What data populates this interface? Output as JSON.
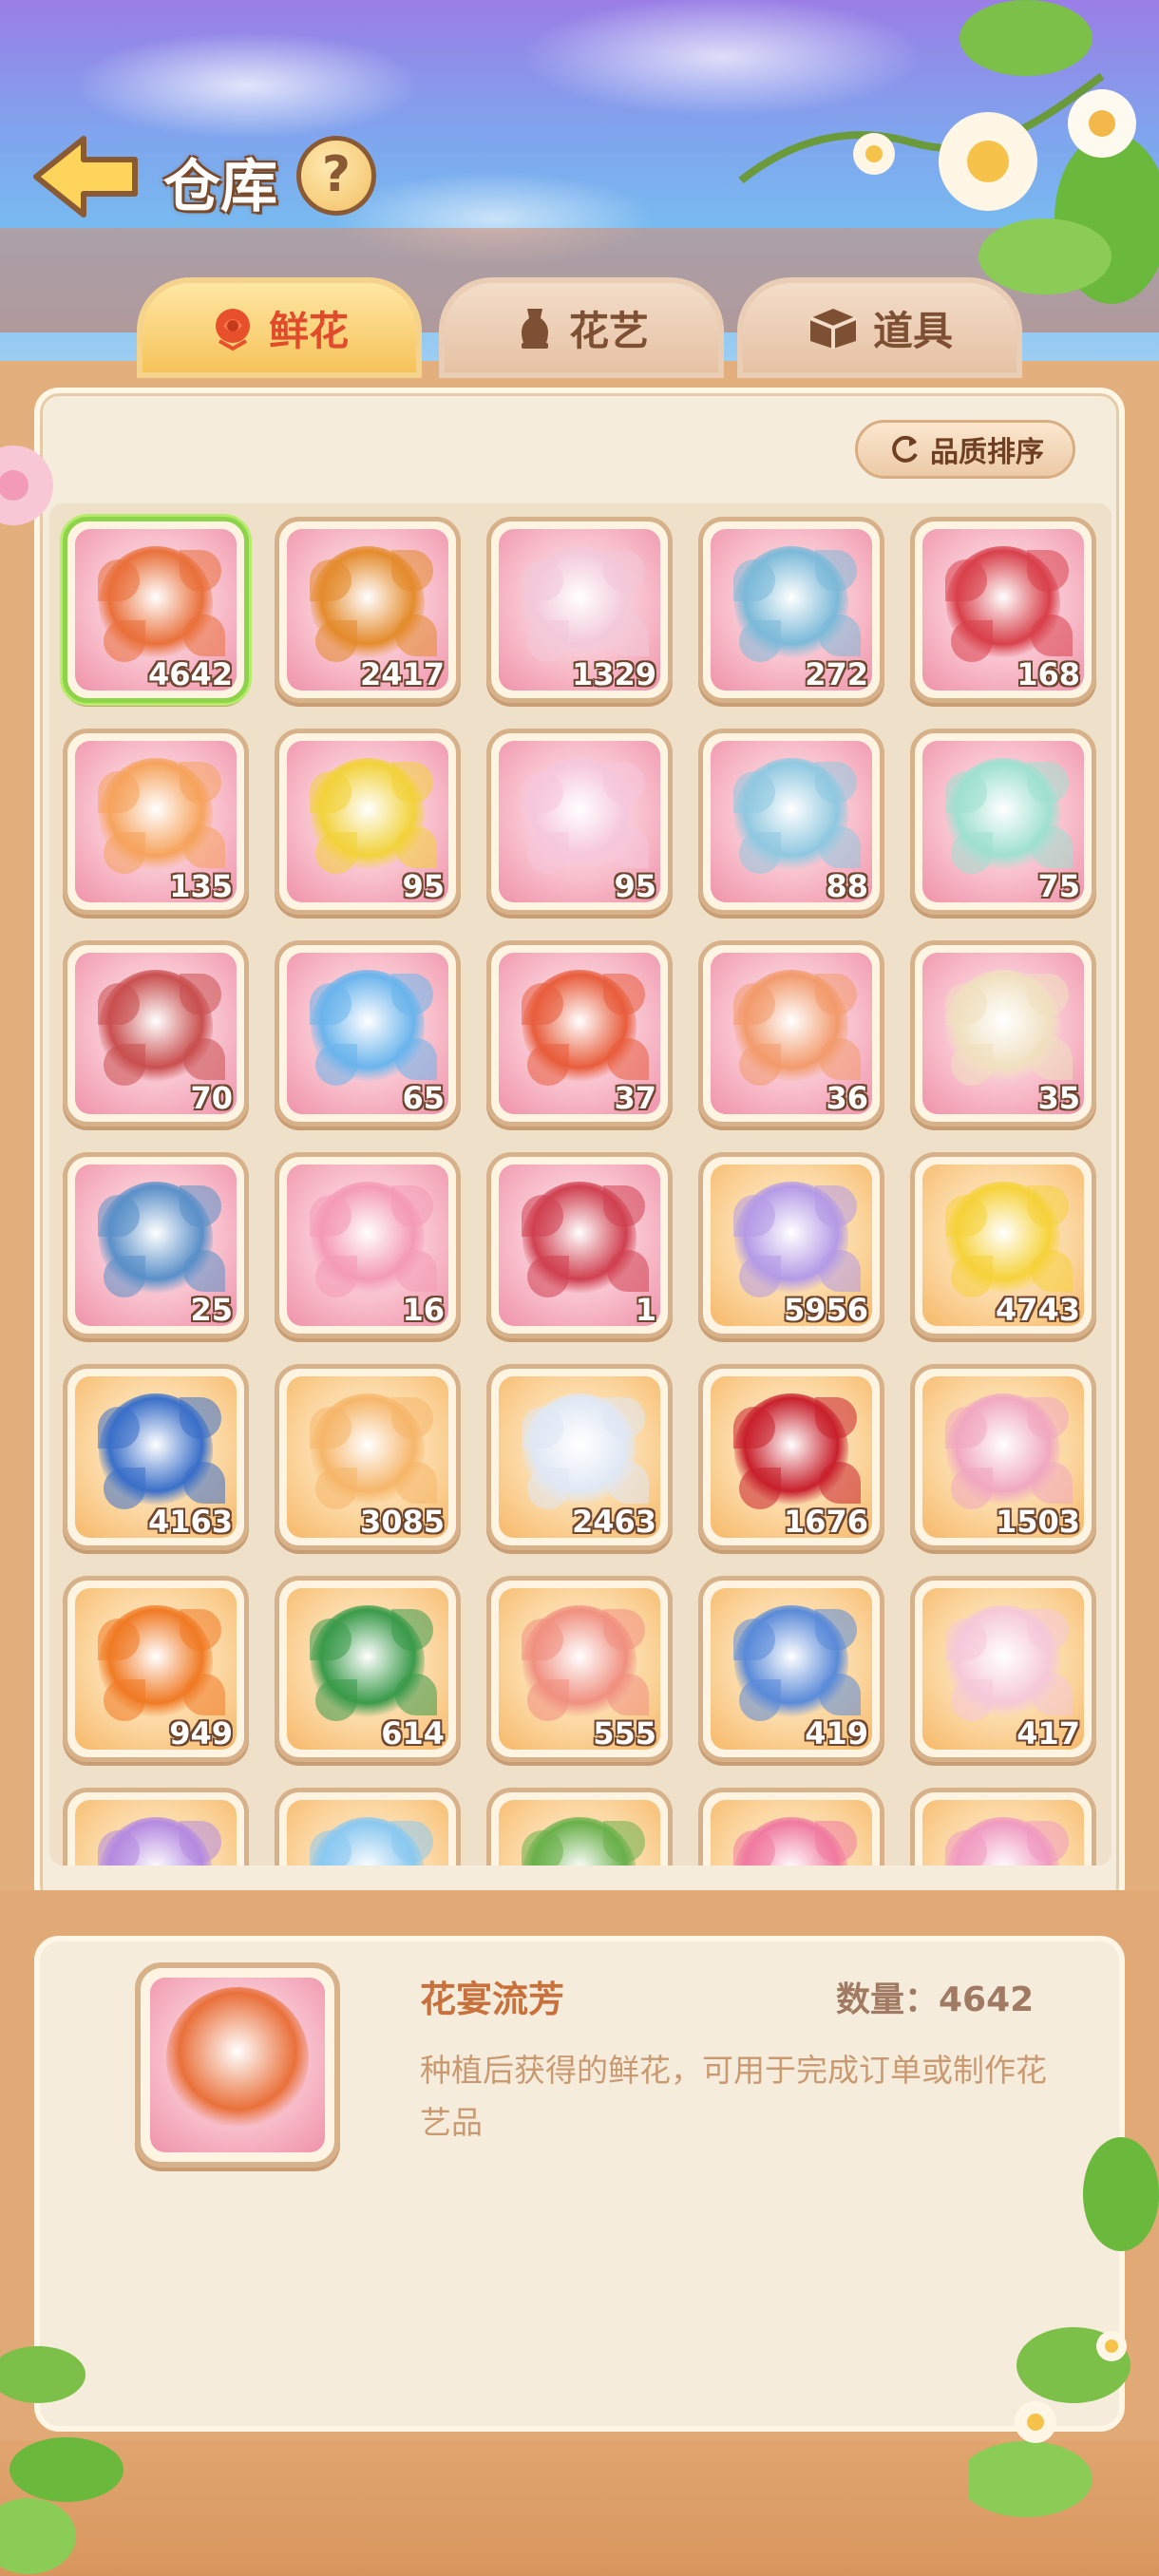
{
  "header": {
    "title": "仓库",
    "help_label": "?"
  },
  "tabs": [
    {
      "label": "鲜花",
      "active": true,
      "icon": "rose-icon"
    },
    {
      "label": "花艺",
      "active": false,
      "icon": "vase-icon"
    },
    {
      "label": "道具",
      "active": false,
      "icon": "box-icon"
    }
  ],
  "sort_button": {
    "label": "品质排序",
    "icon": "refresh-icon"
  },
  "items": [
    {
      "count": "4642",
      "bg": "pink",
      "color": "#e9703a",
      "selected": true
    },
    {
      "count": "2417",
      "bg": "pink",
      "color": "#e48b2c"
    },
    {
      "count": "1329",
      "bg": "pink",
      "color": "#f3c8d8"
    },
    {
      "count": "272",
      "bg": "pink",
      "color": "#7bb9d8"
    },
    {
      "count": "168",
      "bg": "pink",
      "color": "#d8404a"
    },
    {
      "count": "135",
      "bg": "pink",
      "color": "#f6a35c"
    },
    {
      "count": "95",
      "bg": "pink",
      "color": "#f2d23b"
    },
    {
      "count": "95",
      "bg": "pink",
      "color": "#f6c6dc"
    },
    {
      "count": "88",
      "bg": "pink",
      "color": "#8fc8e0"
    },
    {
      "count": "75",
      "bg": "pink",
      "color": "#9fe0d0"
    },
    {
      "count": "70",
      "bg": "pink",
      "color": "#c94f4f"
    },
    {
      "count": "65",
      "bg": "pink",
      "color": "#6ab4ec"
    },
    {
      "count": "37",
      "bg": "pink",
      "color": "#e85d3c"
    },
    {
      "count": "36",
      "bg": "pink",
      "color": "#f29a6c"
    },
    {
      "count": "35",
      "bg": "pink",
      "color": "#f0e0c0"
    },
    {
      "count": "25",
      "bg": "pink",
      "color": "#5a8fc8"
    },
    {
      "count": "16",
      "bg": "pink",
      "color": "#f49ab4"
    },
    {
      "count": "1",
      "bg": "pink",
      "color": "#d04050"
    },
    {
      "count": "5956",
      "bg": "gold",
      "color": "#b49ae6"
    },
    {
      "count": "4743",
      "bg": "gold",
      "color": "#f6d23a"
    },
    {
      "count": "4163",
      "bg": "gold",
      "color": "#3a6fc8"
    },
    {
      "count": "3085",
      "bg": "gold",
      "color": "#f6b66a"
    },
    {
      "count": "2463",
      "bg": "gold",
      "color": "#e0e8f4"
    },
    {
      "count": "1676",
      "bg": "gold",
      "color": "#c8202c"
    },
    {
      "count": "1503",
      "bg": "gold",
      "color": "#f0a8c0"
    },
    {
      "count": "949",
      "bg": "gold",
      "color": "#f07a24"
    },
    {
      "count": "614",
      "bg": "gold",
      "color": "#3a9a4a"
    },
    {
      "count": "555",
      "bg": "gold",
      "color": "#f09080"
    },
    {
      "count": "419",
      "bg": "gold",
      "color": "#5a8ad8"
    },
    {
      "count": "417",
      "bg": "gold",
      "color": "#f6c8d8"
    },
    {
      "count": "",
      "bg": "gold",
      "color": "#b48ae0"
    },
    {
      "count": "",
      "bg": "gold",
      "color": "#8ac8f0"
    },
    {
      "count": "",
      "bg": "gold",
      "color": "#6ab04a"
    },
    {
      "count": "",
      "bg": "gold",
      "color": "#f07aa0"
    },
    {
      "count": "",
      "bg": "gold",
      "color": "#f09ac0"
    }
  ],
  "detail": {
    "name": "花宴流芳",
    "quantity_label": "数量：4642",
    "description": "种植后获得的鲜花，可用于完成订单或制作花艺品"
  }
}
